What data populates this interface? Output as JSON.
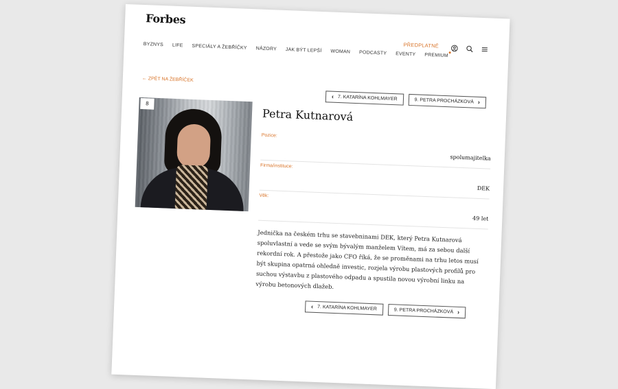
{
  "header": {
    "logo": "Forbes",
    "subscribe": "PŘEDPLATNÉ",
    "icons": [
      "user-icon",
      "search-icon",
      "menu-icon"
    ]
  },
  "nav": [
    "BYZNYS",
    "LIFE",
    "SPECIÁLY A ŽEBŘÍČKY",
    "NÁZORY",
    "JAK BÝT LEPŠÍ",
    "WOMAN",
    "PODCASTY",
    "EVENTY",
    "PREMIUM"
  ],
  "back_link": "← ZPĚT NA ŽEBŘÍČEK",
  "pager": {
    "prev": "7. KATARÍNA KOHLMAYER",
    "next": "9. PETRA PROCHÁZKOVÁ"
  },
  "profile": {
    "rank": "8",
    "name": "Petra Kutnarová",
    "fields": [
      {
        "label": "Pozice:",
        "value": "spolumajitelka"
      },
      {
        "label": "Firma/instituce:",
        "value": "DEK"
      },
      {
        "label": "Věk:",
        "value": "49 let"
      }
    ],
    "description": "Jednička na českém trhu se stavebninami DEK, který Petra Kutnarová spoluvlastní a vede se svým bývalým manželem Vítem, má za sebou další rekordní rok. A přestože jako CFO říká, že se proměnami na trhu letos musí být skupina opatrná ohledně investic, rozjela výrobu plastových profilů pro suchou výstavbu z plastového odpadu a spustila novou výrobní linku na výrobu betonových dlažeb."
  },
  "colors": {
    "accent": "#d9752b",
    "background": "#e9e9e9",
    "page": "#ffffff"
  }
}
